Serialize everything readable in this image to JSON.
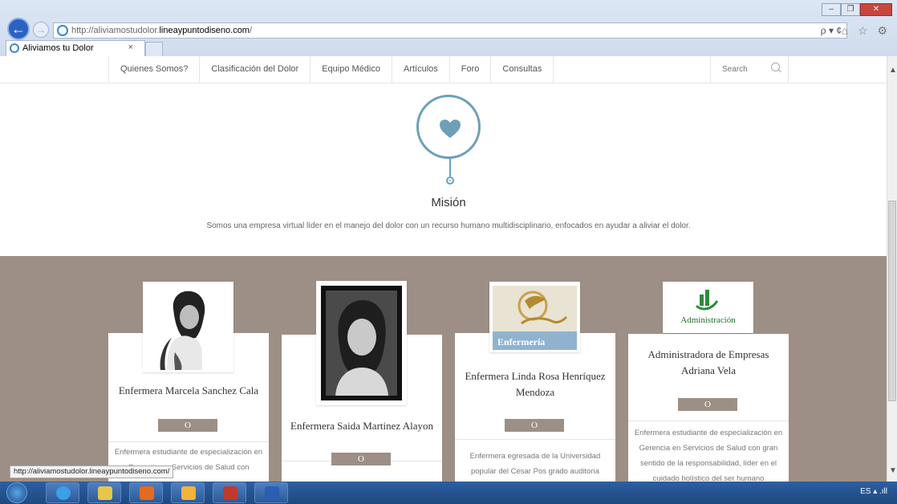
{
  "browser": {
    "url_prefix": "http://aliviamostudolor.",
    "url_domain": "lineaypuntodiseno.com",
    "url_suffix": "/",
    "tab_title": "Aliviamos tu Dolor",
    "tab_close": "×",
    "address_tools": "ρ ▾ ¢",
    "right_icons": "⌂ ☆ ⚙",
    "window_controls": [
      "–",
      "❐",
      "✕"
    ]
  },
  "nav": {
    "items": [
      "Quienes Somos?",
      "Clasificación del Dolor",
      "Equipo Médico",
      "Artículos",
      "Foro",
      "Consultas"
    ],
    "search_placeholder": "Search"
  },
  "mission": {
    "icon": "heart-icon",
    "title": "Misión",
    "text": "Somos una empresa virtual líder en el manejo del dolor con un recurso humano multidisciplinario, enfocados en ayudar a aliviar el dolor."
  },
  "team": [
    {
      "name": "Enfermera Marcela Sanchez Cala",
      "button": "O",
      "description": "Enfermera estudiante de especialización en Gerencia en Servicios de Salud con"
    },
    {
      "name": "Enfermera Saida Martinez Alayon",
      "button": "O",
      "description": ""
    },
    {
      "name": "Enfermera Linda Rosa Henríquez Mendoza",
      "button": "O",
      "description": "Enfermera egresada de la Universidad popular del Cesar Pos grado auditoria",
      "logo_text": "Enfermería"
    },
    {
      "name": "Administradora de Empresas Adriana Vela",
      "button": "O",
      "description": "Enfermera estudiante de especialización en Gerencia en Servicios de Salud con gran sentido de la responsabilidad, líder en el cuidado holístico del ser humano",
      "logo_text": "Administración"
    }
  ],
  "status_bar_url": "http://aliviamostudolor.lineaypuntodiseno.com/",
  "taskbar": {
    "apps": [
      "ie-icon",
      "file-explorer-icon",
      "media-player-icon",
      "outlook-icon",
      "access-icon",
      "word-icon"
    ],
    "tray_text": "ES  ▴  .ıll"
  },
  "colors": {
    "accent": "#6d9fb9",
    "team_bg": "#9d8f85"
  }
}
